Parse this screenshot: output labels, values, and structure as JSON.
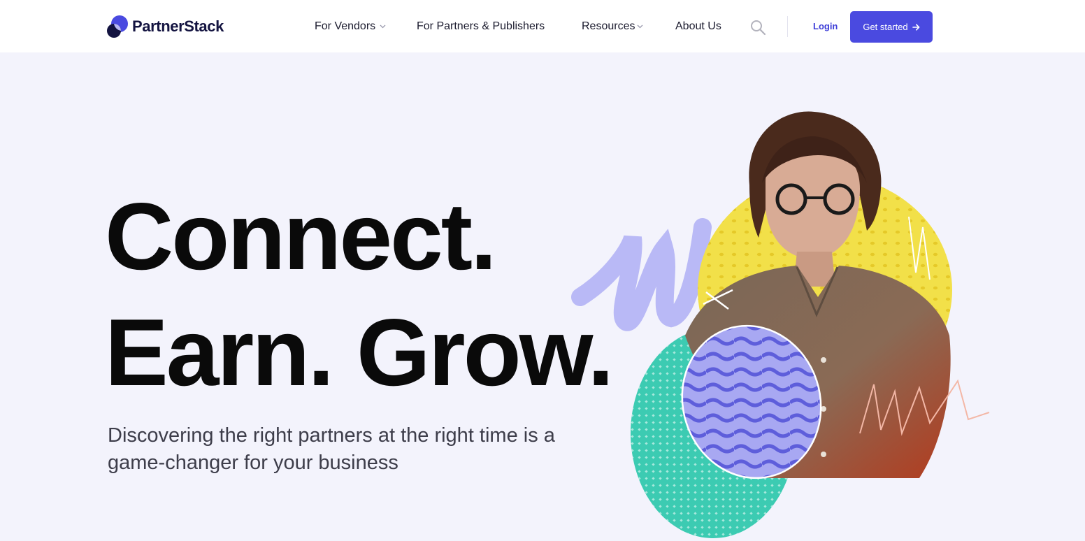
{
  "brand": {
    "name": "PartnerStack",
    "logo_icon": "partnerstack-logo-icon",
    "color": "#131340"
  },
  "nav": {
    "items": [
      {
        "label": "For Vendors",
        "has_dropdown": true
      },
      {
        "label": "For Partners & Publishers",
        "has_dropdown": false
      },
      {
        "label": "Resources",
        "has_dropdown": true
      },
      {
        "label": "About Us",
        "has_dropdown": false
      }
    ],
    "search_icon": "search-icon",
    "login_label": "Login",
    "cta_label": "Get started",
    "cta_icon": "arrow-right-icon"
  },
  "hero": {
    "line1": "Connect.",
    "line2": "Earn. Grow.",
    "subtitle": "Discovering the right partners at the right time is a game-changer for your business"
  },
  "colors": {
    "accent": "#4a4ae0",
    "background": "#f3f3fc",
    "yellow_blob": "#f2e049",
    "teal_blob": "#3ccbb2",
    "wave_blob": "#8f8ff0"
  }
}
